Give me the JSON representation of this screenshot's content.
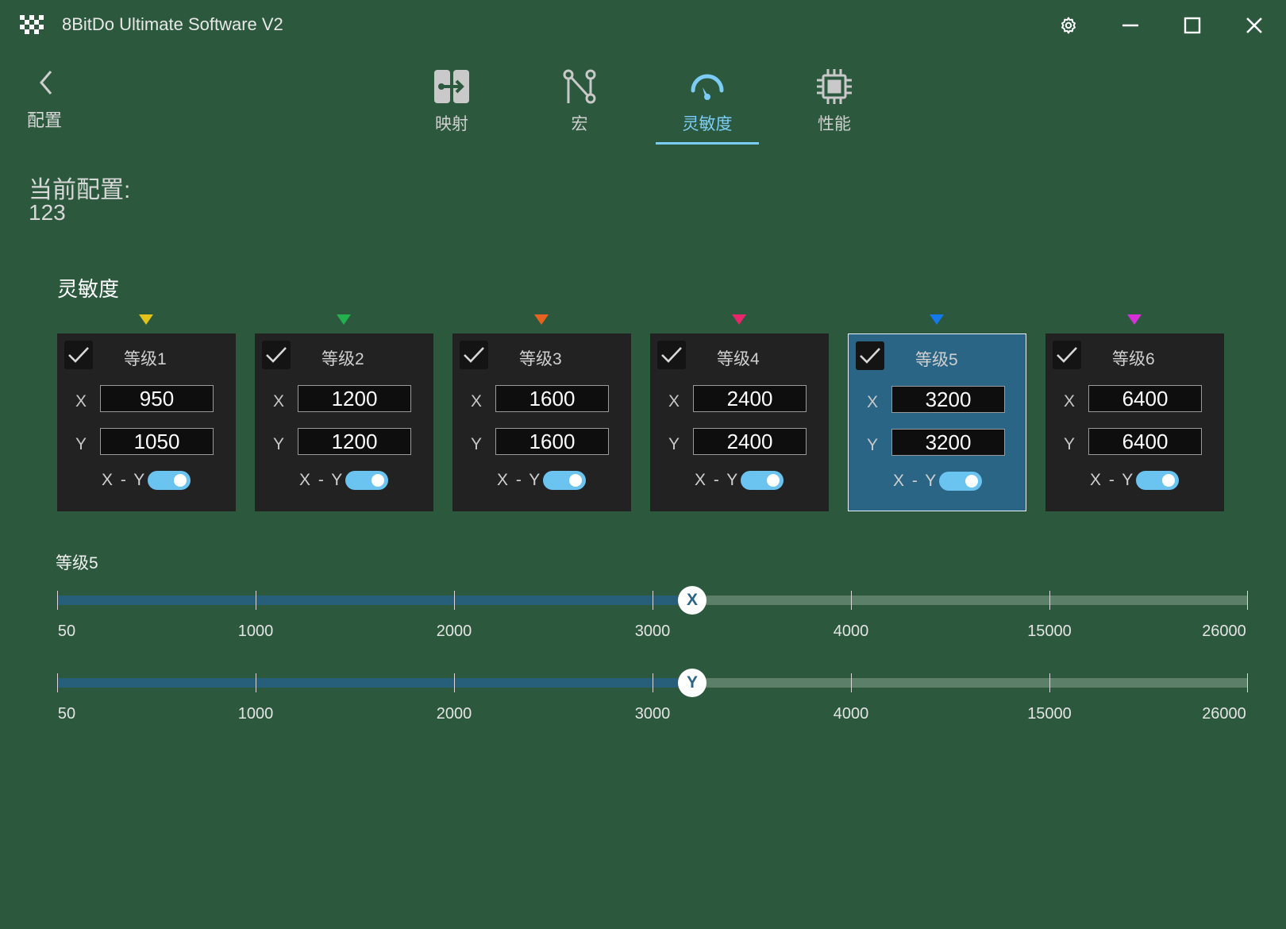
{
  "window": {
    "title": "8BitDo Ultimate Software V2"
  },
  "nav": {
    "back_label": "配置"
  },
  "tabs": [
    {
      "label": "映射",
      "icon": "mapping-icon",
      "active": false
    },
    {
      "label": "宏",
      "icon": "macro-icon",
      "active": false
    },
    {
      "label": "灵敏度",
      "icon": "sensitivity-gauge-icon",
      "active": true
    },
    {
      "label": "性能",
      "icon": "chip-icon",
      "active": false
    }
  ],
  "current_config": {
    "label": "当前配置:",
    "value": "123"
  },
  "section_title": "灵敏度",
  "levels": [
    {
      "title": "等级1",
      "x": "950",
      "y": "1050",
      "color": "#e3c21b",
      "checked": true,
      "linked": true,
      "selected": false
    },
    {
      "title": "等级2",
      "x": "1200",
      "y": "1200",
      "color": "#22b14c",
      "checked": true,
      "linked": true,
      "selected": false
    },
    {
      "title": "等级3",
      "x": "1600",
      "y": "1600",
      "color": "#e8621f",
      "checked": true,
      "linked": true,
      "selected": false
    },
    {
      "title": "等级4",
      "x": "2400",
      "y": "2400",
      "color": "#e8266b",
      "checked": true,
      "linked": true,
      "selected": false
    },
    {
      "title": "等级5",
      "x": "3200",
      "y": "3200",
      "color": "#1479ea",
      "checked": true,
      "linked": true,
      "selected": true
    },
    {
      "title": "等级6",
      "x": "6400",
      "y": "6400",
      "color": "#d631d8",
      "checked": true,
      "linked": true,
      "selected": false
    }
  ],
  "axis_labels": {
    "x": "X",
    "y": "Y",
    "link": "X - Y"
  },
  "slider_section": {
    "level_label": "等级5",
    "ticks": [
      "50",
      "1000",
      "2000",
      "3000",
      "4000",
      "15000",
      "26000"
    ],
    "x_slider": {
      "thumb": "X",
      "value": 3200
    },
    "y_slider": {
      "thumb": "Y",
      "value": 3200
    }
  },
  "colors": {
    "accent": "#7ccdf5",
    "background": "#2c583e",
    "card": "#222222",
    "selected_card": "#2a6585"
  }
}
